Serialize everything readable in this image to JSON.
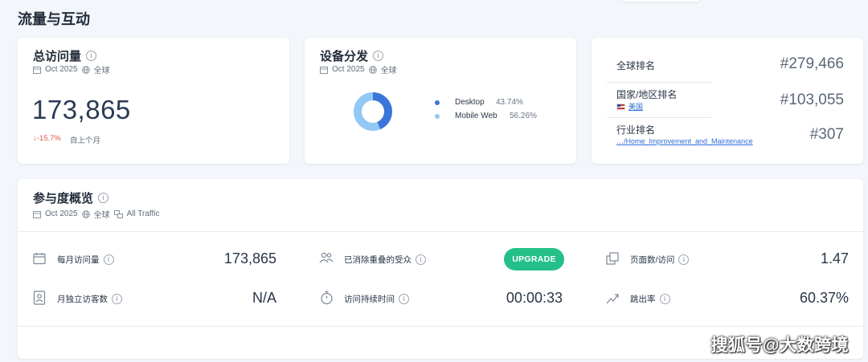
{
  "section": {
    "title": "流量与互动"
  },
  "total_visits": {
    "title": "总访问量",
    "date": "Oct 2025",
    "region": "全球",
    "value": "173,865",
    "change": "↓-15.7%",
    "change_note": "自上个月",
    "change_color": "#e0554a"
  },
  "device_distribution": {
    "title": "设备分发",
    "date": "Oct 2025",
    "region": "全球",
    "chart_data": {
      "type": "pie",
      "categories": [
        "Desktop",
        "Mobile Web"
      ],
      "values": [
        43.74,
        56.26
      ],
      "labels": [
        "43.74%",
        "56.26%"
      ],
      "colors": [
        "#3a76d8",
        "#93c8f5"
      ]
    }
  },
  "rankings": {
    "global": {
      "label": "全球排名",
      "value": "#279,466"
    },
    "country": {
      "label": "国家/地区排名",
      "sub": "美国",
      "value": "#103,055"
    },
    "industry": {
      "label": "行业排名",
      "sub": "…/Home_Improvement_and_Maintenance",
      "value": "#307"
    }
  },
  "engagement": {
    "title": "参与度概览",
    "date": "Oct 2025",
    "region": "全球",
    "traffic": "All Traffic",
    "metrics": {
      "monthly_visits": {
        "label": "每月访问量",
        "value": "173,865",
        "icon": "calendar-icon"
      },
      "unique_visitors": {
        "label": "月独立访客数",
        "value": "N/A",
        "icon": "id-card-icon"
      },
      "deduplicated_audience": {
        "label": "已消除重叠的受众",
        "button": "UPGRADE",
        "icon": "users-icon"
      },
      "visit_duration": {
        "label": "访问持续时间",
        "value": "00:00:33",
        "icon": "stopwatch-icon"
      },
      "pages_per_visit": {
        "label": "页面数/访问",
        "value": "1.47",
        "icon": "pages-icon"
      },
      "bounce_rate": {
        "label": "跳出率",
        "value": "60.37%",
        "icon": "trend-icon"
      }
    },
    "accent_color": "#25c08a"
  },
  "watermark": "搜狐号@大数跨境"
}
